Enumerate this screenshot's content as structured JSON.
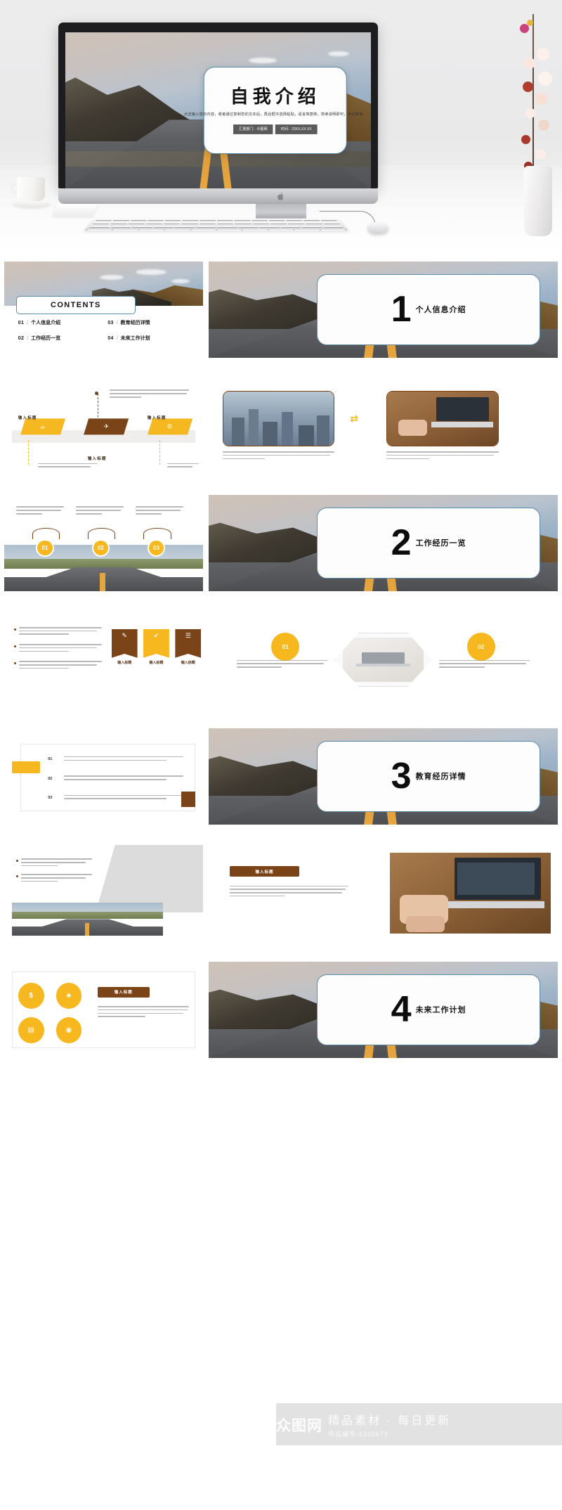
{
  "hero": {
    "title": "自我介绍",
    "subtitle": "点击输入您的内容，或者通过复制您的文本后，再此框中选择粘贴，请言简意赅，简单说明即可，不必繁琐。",
    "tag_department": "汇报部门：众图网",
    "tag_date": "时间：20XX.XX.XX"
  },
  "contents": {
    "heading": "CONTENTS",
    "items": [
      {
        "num": "01",
        "sep": "/",
        "label": "个人信息介绍"
      },
      {
        "num": "03",
        "sep": "/",
        "label": "教育经历详情"
      },
      {
        "num": "02",
        "sep": "/",
        "label": "工作经历一览"
      },
      {
        "num": "04",
        "sep": "/",
        "label": "未来工作计划"
      }
    ]
  },
  "sections": [
    {
      "num": "1",
      "title": "个人信息介绍"
    },
    {
      "num": "2",
      "title": "工作经历一览"
    },
    {
      "num": "3",
      "title": "教育经历详情"
    },
    {
      "num": "4",
      "title": "未来工作计划"
    }
  ],
  "body_text": "点击输入您的内容，或者通过复制您的文本后，再此框中选择粘贴，请言简意赅，简单说明即可，不必繁琐。",
  "placeholder_title": "输入标题",
  "timeline": {
    "labels": [
      "输入标题",
      "输入标题",
      "输入标题"
    ],
    "icons": [
      "☕",
      "✈",
      "⚙"
    ],
    "body": "点击输入您的内容，或者通过复制您的文本后，再此框中选择粘贴，请言简意赅，简单说明即可，不必繁琐。"
  },
  "compare": {
    "swap_icon": "⇄",
    "body": "点击输入您的内容，或者通过复制您的文本后，再此框中选择粘贴，请言简意赅，简单说明即可。"
  },
  "numbered_badges": [
    "01",
    "02",
    "03"
  ],
  "hex_badges": [
    "01",
    "02"
  ],
  "ribbons": [
    {
      "icon": "✎",
      "label": "输入标题",
      "color": "#7a4318"
    },
    {
      "icon": "✔",
      "label": "输入标题",
      "color": "#f7b71f"
    },
    {
      "icon": "☰",
      "label": "输入标题",
      "color": "#7a4318"
    }
  ],
  "numbered_rows": [
    "01",
    "02",
    "03"
  ],
  "icon_grid": [
    {
      "glyph": "$",
      "name": "money-icon"
    },
    {
      "glyph": "♣",
      "name": "chart-icon"
    },
    {
      "glyph": "▤",
      "name": "calendar-icon"
    },
    {
      "glyph": "◉",
      "name": "compass-icon"
    }
  ],
  "watermark": {
    "logo": "众图网",
    "tagline": "精品素材 · 每日更新",
    "code": "作品编号:4320673"
  },
  "colors": {
    "accent_blue": "#5b8ba6",
    "accent_yellow": "#f7b71f",
    "accent_brown": "#7a4318",
    "ink": "#111111"
  }
}
